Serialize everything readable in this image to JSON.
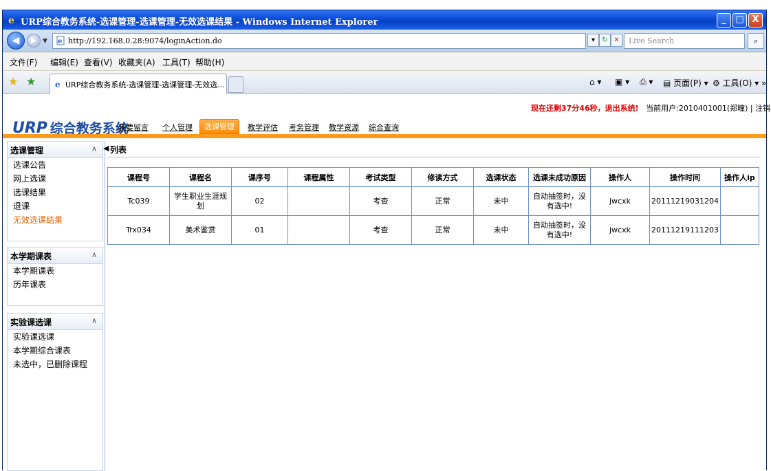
{
  "window": {
    "title": "URP综合教务系统-选课管理-选课管理-无效选课结果 - Windows Internet Explorer",
    "minimize": "_",
    "maximize": "□",
    "close": "X"
  },
  "address": {
    "url": "http://192.168.0.28:9074/loginAction.do",
    "search_placeholder": "Live Search"
  },
  "menu": [
    "文件(F)",
    "编辑(E)",
    "查看(V)",
    "收藏夹(A)",
    "工具(T)",
    "帮助(H)"
  ],
  "tab": {
    "label": "URP综合教务系统-选课管理-选课管理-无效选...",
    "page_label": "页面(P)",
    "tools_label": "工具(O)"
  },
  "header": {
    "logo_brand": "URP",
    "logo_name": "综合教务系统",
    "countdown": "现在还剩37分46秒，退出系统!",
    "user_label": "当前用户:2010401001(郑曈)",
    "logout": "注销"
  },
  "nav": {
    "items": [
      "我要留言",
      "个人管理",
      "选课管理",
      "教学评估",
      "考务管理",
      "教学资源",
      "综合查询"
    ],
    "active_index": 2
  },
  "sidebar": {
    "sections": [
      {
        "title": "选课管理",
        "items": [
          "选课公告",
          "网上选课",
          "选课结果",
          "退课",
          "无效选课结果"
        ],
        "active": 4
      },
      {
        "title": "本学期课表",
        "items": [
          "本学期课表",
          "历年课表"
        ]
      },
      {
        "title": "实验课选课",
        "items": [
          "实验课选课",
          "本学期综合课表",
          "未选中，已删除课程"
        ]
      }
    ]
  },
  "list": {
    "title": "列表",
    "columns": [
      "课程号",
      "课程名",
      "课序号",
      "课程属性",
      "考试类型",
      "修读方式",
      "选课状态",
      "选课未成功原因",
      "操作人",
      "操作时间",
      "操作人ip"
    ],
    "rows": [
      [
        "Tc039",
        "学生职业生涯规划",
        "02",
        "",
        "考查",
        "正常",
        "未中",
        "自动抽签时，没有选中!",
        "jwcxk",
        "20111219031204",
        ""
      ],
      [
        "Trx034",
        "美术鉴赏",
        "01",
        "",
        "考查",
        "正常",
        "未中",
        "自动抽签时，没有选中!",
        "jwcxk",
        "20111219111203",
        ""
      ]
    ]
  }
}
